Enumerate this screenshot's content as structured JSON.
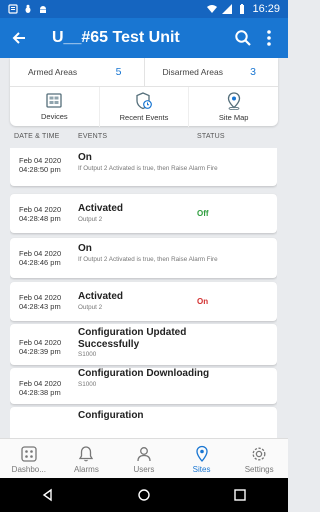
{
  "status_bar": {
    "time": "16:29"
  },
  "app_bar": {
    "title": "U__#65 Test Unit"
  },
  "summary": {
    "armed_label": "Armed Areas",
    "armed_count": "5",
    "disarmed_label": "Disarmed Areas",
    "disarmed_count": "3",
    "tiles": [
      {
        "label": "Devices",
        "icon": "devices-icon"
      },
      {
        "label": "Recent Events",
        "icon": "shield-clock-icon"
      },
      {
        "label": "Site Map",
        "icon": "map-pin-icon"
      }
    ]
  },
  "columns": {
    "date": "DATE & TIME",
    "events": "EVENTS",
    "status": "STATUS"
  },
  "events": [
    {
      "date": "Feb 04 2020",
      "time": "04:28:50 pm",
      "title": "On",
      "sub": "If Output 2 Activated is true, then Raise Alarm Fire",
      "status": ""
    },
    {
      "date": "Feb 04 2020",
      "time": "04:28:48 pm",
      "title": "Activated",
      "sub": "Output 2",
      "status": "Off"
    },
    {
      "date": "Feb 04 2020",
      "time": "04:28:46 pm",
      "title": "On",
      "sub": "If Output 2 Activated is true, then Raise Alarm Fire",
      "status": ""
    },
    {
      "date": "Feb 04 2020",
      "time": "04:28:43 pm",
      "title": "Activated",
      "sub": "Output 2",
      "status": "On"
    },
    {
      "date": "Feb 04 2020",
      "time": "04:28:39 pm",
      "title": "Configuration Updated Successfully",
      "sub": "S1000",
      "status": ""
    },
    {
      "date": "Feb 04 2020",
      "time": "04:28:38 pm",
      "title": "Configuration Downloading",
      "sub": "S1000",
      "status": ""
    },
    {
      "date": "",
      "time": "",
      "title": "Configuration",
      "sub": "",
      "status": ""
    }
  ],
  "colors": {
    "primary": "#1976d2",
    "status_off": "#2e9e3e",
    "status_on": "#d32f2f"
  },
  "bottom_nav": [
    {
      "label": "Dashbo...",
      "icon": "dashboard-icon"
    },
    {
      "label": "Alarms",
      "icon": "bell-icon"
    },
    {
      "label": "Users",
      "icon": "users-icon"
    },
    {
      "label": "Sites",
      "icon": "location-icon"
    },
    {
      "label": "Settings",
      "icon": "gear-icon"
    }
  ]
}
